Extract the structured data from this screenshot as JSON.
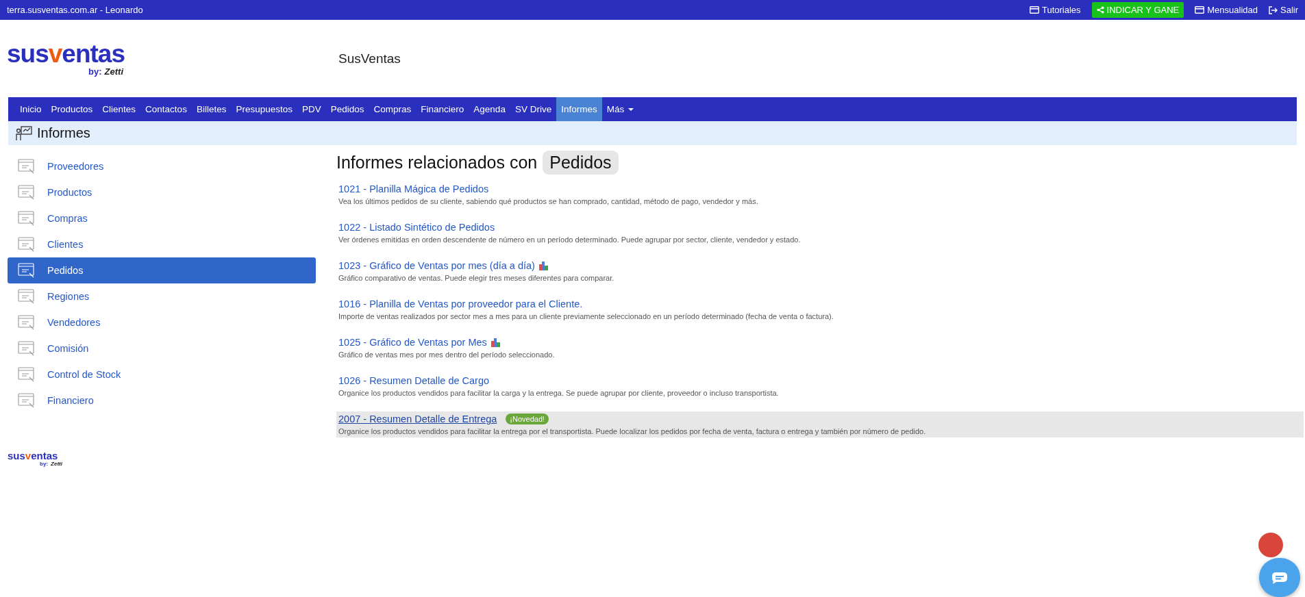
{
  "topbar": {
    "site": "terra.susventas.com.ar - Leonardo",
    "links": [
      {
        "kind": "tutorial",
        "label": "Tutoriales"
      },
      {
        "kind": "promo",
        "label": "INDICAR Y GANE"
      },
      {
        "kind": "card",
        "label": "Mensualidad"
      },
      {
        "kind": "exit",
        "label": "Salir"
      }
    ]
  },
  "logo": {
    "prefix": "sus",
    "accent": "v",
    "suffix": "entas",
    "by": "by:",
    "brand": "Zetti"
  },
  "app_title": "SusVentas",
  "nav": [
    {
      "label": "Inicio",
      "selected": false
    },
    {
      "label": "Productos",
      "selected": false
    },
    {
      "label": "Clientes",
      "selected": false
    },
    {
      "label": "Contactos",
      "selected": false
    },
    {
      "label": "Billetes",
      "selected": false
    },
    {
      "label": "Presupuestos",
      "selected": false
    },
    {
      "label": "PDV",
      "selected": false
    },
    {
      "label": "Pedidos",
      "selected": false
    },
    {
      "label": "Compras",
      "selected": false
    },
    {
      "label": "Financiero",
      "selected": false
    },
    {
      "label": "Agenda",
      "selected": false
    },
    {
      "label": "SV Drive",
      "selected": false
    },
    {
      "label": "Informes",
      "selected": true
    },
    {
      "label": "Más",
      "selected": false,
      "dropdown": true
    }
  ],
  "section_title": "Informes",
  "sidebar": {
    "items": [
      {
        "label": "Proveedores",
        "selected": false
      },
      {
        "label": "Productos",
        "selected": false
      },
      {
        "label": "Compras",
        "selected": false
      },
      {
        "label": "Clientes",
        "selected": false
      },
      {
        "label": "Pedidos",
        "selected": true
      },
      {
        "label": "Regiones",
        "selected": false
      },
      {
        "label": "Vendedores",
        "selected": false
      },
      {
        "label": "Comisión",
        "selected": false
      },
      {
        "label": "Control de Stock",
        "selected": false
      },
      {
        "label": "Financiero",
        "selected": false
      }
    ]
  },
  "content": {
    "heading": "Informes relacionados con",
    "category": "Pedidos",
    "reports": [
      {
        "title": "1021 - Planilla Mágica de Pedidos",
        "description": "Vea los últimos pedidos de su cliente, sabiendo qué productos se han comprado, cantidad, método de pago, vendedor y más.",
        "chart_icon": false,
        "highlighted": false
      },
      {
        "title": "1022 - Listado Sintético de Pedidos",
        "description": "Ver órdenes emitidas en orden descendente de número en un período determinado. Puede agrupar por sector, cliente, vendedor y estado.",
        "chart_icon": false,
        "highlighted": false
      },
      {
        "title": "1023 - Gráfico de Ventas por mes (día a día)",
        "description": "Gráfico comparativo de ventas. Puede elegir tres meses diferentes para comparar.",
        "chart_icon": true,
        "highlighted": false
      },
      {
        "title": "1016 - Planilla de Ventas por proveedor para el Cliente.",
        "description": "Importe de ventas realizados por sector mes a mes para un cliente previamente seleccionado en un período determinado (fecha de venta o factura).",
        "chart_icon": false,
        "highlighted": false
      },
      {
        "title": "1025 - Gráfico de Ventas por Mes",
        "description": "Gráfico de ventas mes por mes dentro del período seleccionado.",
        "chart_icon": true,
        "highlighted": false
      },
      {
        "title": "1026 - Resumen Detalle de Cargo",
        "description": "Organice los productos vendidos para facilitar la carga y la entrega. Se puede agrupar por cliente, proveedor o incluso transportista.",
        "chart_icon": false,
        "highlighted": false
      },
      {
        "title": "2007 - Resumen Detalle de Entrega",
        "description": "Organice los productos vendidos para facilitar la entrega por el transportista. Puede localizar los pedidos por fecha de venta, factura o entrega y también por número de pedido.",
        "chart_icon": false,
        "highlighted": true,
        "badge": "¡Novedad!"
      }
    ]
  },
  "footer_logo": {
    "prefix": "sus",
    "accent": "v",
    "suffix": "entas",
    "by": "by:",
    "brand": "Zetti"
  }
}
